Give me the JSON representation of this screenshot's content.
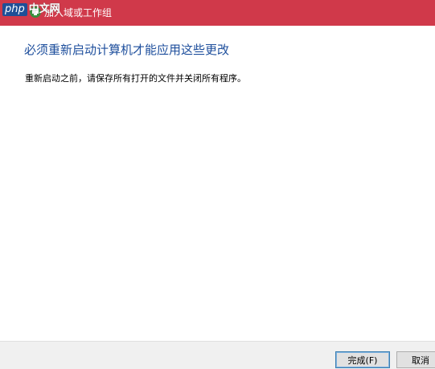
{
  "watermark": {
    "php": "php",
    "cn": "中文网"
  },
  "window": {
    "title": "加入域或工作组",
    "icon": "computer-group-icon"
  },
  "content": {
    "heading": "必须重新启动计算机才能应用这些更改",
    "message": "重新启动之前，请保存所有打开的文件并关闭所有程序。"
  },
  "buttons": {
    "finish": "完成(F)",
    "cancel": "取消"
  },
  "colors": {
    "titlebar": "#d0394a",
    "heading": "#1d4e9c",
    "footer": "#f0f0f0"
  }
}
